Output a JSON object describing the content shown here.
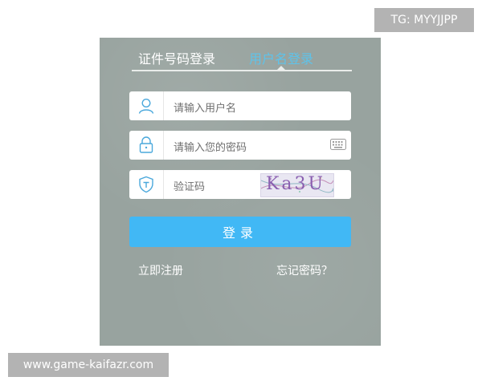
{
  "watermarks": {
    "top_right": "TG: MYYJJPP",
    "bottom_left": "www.game-kaifazr.com"
  },
  "tabs": [
    {
      "label": "证件号码登录",
      "active": false
    },
    {
      "label": "用户名登录",
      "active": true
    }
  ],
  "colors": {
    "panel_bg": "#98a39f",
    "active_tab": "#5ec3ea",
    "button_bg": "#41b8f5"
  },
  "fields": {
    "username": {
      "placeholder": "请输入用户名",
      "icon": "user-icon"
    },
    "password": {
      "placeholder": "请输入您的密码",
      "icon": "lock-icon",
      "extra_icon": "keyboard-icon"
    },
    "captcha": {
      "placeholder": "验证码",
      "icon": "shield-icon",
      "captcha_text": "Ka3U"
    }
  },
  "login_button": {
    "label": "登录"
  },
  "links": {
    "register": "立即注册",
    "forgot": "忘记密码？"
  }
}
